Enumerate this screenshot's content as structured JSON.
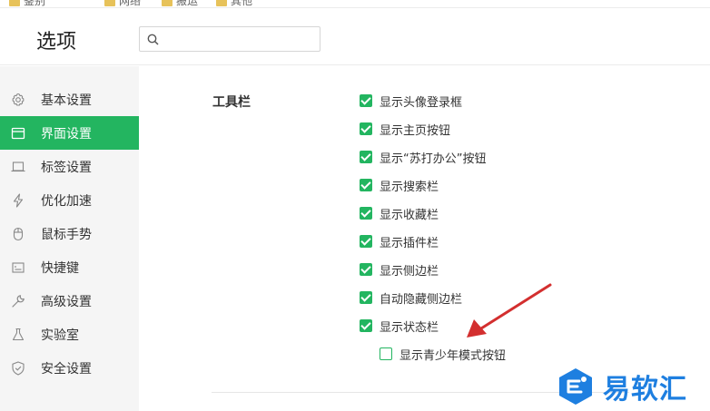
{
  "top_strip": {
    "bookmarks": [
      "鉴别",
      "网络",
      "搬运",
      "其他"
    ]
  },
  "header": {
    "title": "选项",
    "search": {
      "value": "",
      "placeholder": ""
    }
  },
  "sidebar": {
    "items": [
      {
        "label": "基本设置",
        "icon": "gear-icon",
        "active": false
      },
      {
        "label": "界面设置",
        "icon": "window-icon",
        "active": true
      },
      {
        "label": "标签设置",
        "icon": "tab-icon",
        "active": false
      },
      {
        "label": "优化加速",
        "icon": "bolt-icon",
        "active": false
      },
      {
        "label": "鼠标手势",
        "icon": "mouse-icon",
        "active": false
      },
      {
        "label": "快捷键",
        "icon": "keyboard-icon",
        "active": false
      },
      {
        "label": "高级设置",
        "icon": "wrench-icon",
        "active": false
      },
      {
        "label": "实验室",
        "icon": "flask-icon",
        "active": false
      },
      {
        "label": "安全设置",
        "icon": "shield-icon",
        "active": false
      }
    ]
  },
  "toolbar_section": {
    "label": "工具栏",
    "options": [
      {
        "label": "显示头像登录框",
        "checked": true
      },
      {
        "label": "显示主页按钮",
        "checked": true
      },
      {
        "label": "显示“苏打办公”按钮",
        "checked": true
      },
      {
        "label": "显示搜索栏",
        "checked": true
      },
      {
        "label": "显示收藏栏",
        "checked": true
      },
      {
        "label": "显示插件栏",
        "checked": true
      },
      {
        "label": "显示侧边栏",
        "checked": true
      },
      {
        "label": "自动隐藏侧边栏",
        "checked": true
      },
      {
        "label": "显示状态栏",
        "checked": true
      },
      {
        "label": "显示青少年模式按钮",
        "checked": false
      }
    ]
  },
  "watermark": {
    "text": "易软汇"
  },
  "colors": {
    "accent": "#23b560",
    "annotation_arrow": "#d32f2f",
    "watermark": "#1e7fe0"
  }
}
